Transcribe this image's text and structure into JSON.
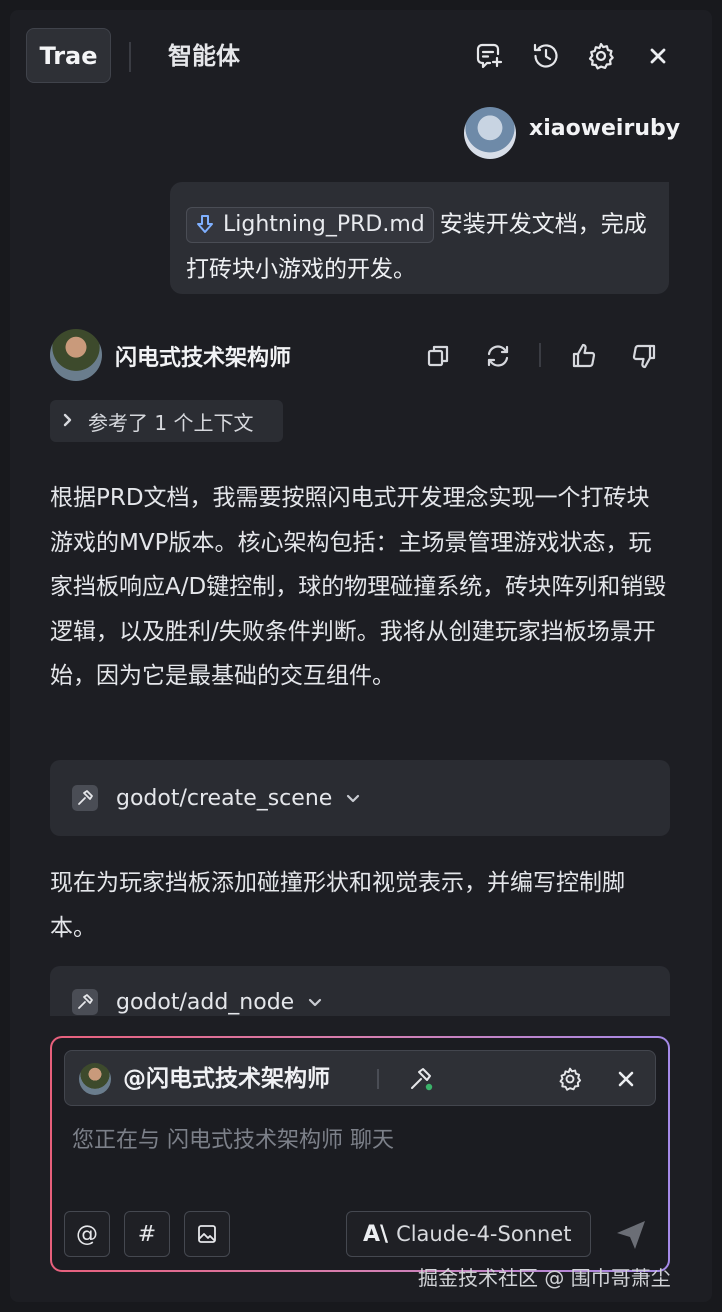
{
  "header": {
    "tabs": [
      {
        "label": "Trae",
        "active": true
      },
      {
        "label": "智能体",
        "active": false
      }
    ],
    "icons": [
      "new-chat-icon",
      "history-icon",
      "settings-icon",
      "close-icon"
    ]
  },
  "user": {
    "name": "xiaoweiruby",
    "message": {
      "file_chip": "Lightning_PRD.md",
      "text": "安装开发文档，完成打砖块小游戏的开发。"
    }
  },
  "agent": {
    "name": "闪电式技术架构师",
    "context_chip": "参考了 1 个上下文",
    "paragraph_1": "根据PRD文档，我需要按照闪电式开发理念实现一个打砖块游戏的MVP版本。核心架构包括：主场景管理游戏状态，玩家挡板响应A/D键控制，球的物理碰撞系统，砖块阵列和销毁逻辑，以及胜利/失败条件判断。我将从创建玩家挡板场景开始，因为它是最基础的交互组件。",
    "tool_call_1": "godot/create_scene",
    "paragraph_2": "现在为玩家挡板添加碰撞形状和视觉表示，并编写控制脚本。",
    "tool_call_2": "godot/add_node"
  },
  "input": {
    "agent_mention": "@闪电式技术架构师",
    "placeholder": "您正在与 闪电式技术架构师 聊天",
    "buttons": {
      "mention": "@",
      "hash": "#"
    },
    "model": {
      "mark": "A\\",
      "name": "Claude-4-Sonnet"
    }
  },
  "watermark": "掘金技术社区 @ 围巾哥萧尘",
  "colors": {
    "background": "#1d1e23",
    "card": "#2a2c32",
    "input_border_start": "#e8607c",
    "input_border_end": "#a58ae8",
    "tool_status_dot": "#3bb36a"
  }
}
